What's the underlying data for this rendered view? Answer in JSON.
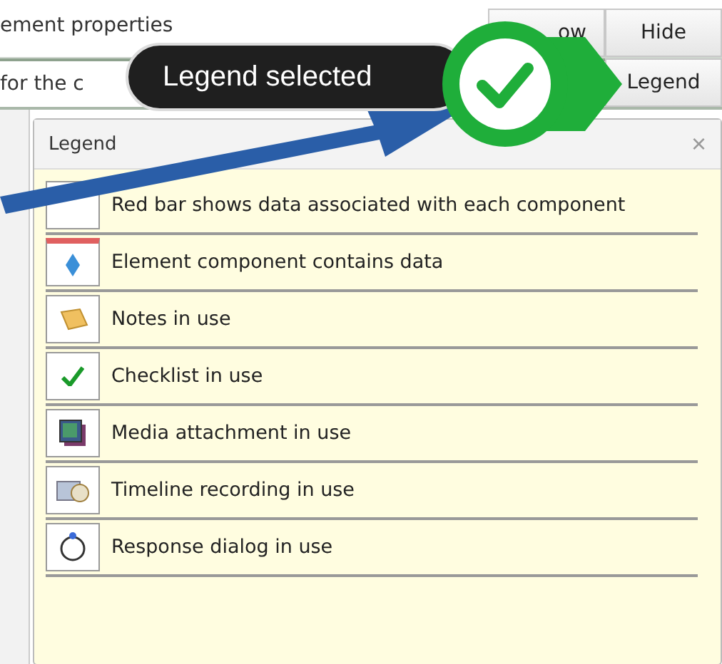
{
  "toolbar": {
    "title": "ement properties",
    "buttons": [
      {
        "label": "ow"
      },
      {
        "label": "Hide"
      }
    ]
  },
  "field": {
    "value": "for the c"
  },
  "legend_button": {
    "label": "Legend"
  },
  "callout": {
    "text": "Legend selected"
  },
  "legend_panel": {
    "title": "Legend",
    "close": "×",
    "items": [
      {
        "kind": "blank",
        "red_bar": false,
        "label": "Red bar shows data associated with each component"
      },
      {
        "kind": "diamond",
        "red_bar": true,
        "label": "Element component contains data"
      },
      {
        "kind": "notes",
        "red_bar": false,
        "label": "Notes in use"
      },
      {
        "kind": "check",
        "red_bar": false,
        "label": "Checklist in use"
      },
      {
        "kind": "media",
        "red_bar": false,
        "label": "Media attachment in use"
      },
      {
        "kind": "timeline",
        "red_bar": false,
        "label": "Timeline recording in use"
      },
      {
        "kind": "response",
        "red_bar": false,
        "label": "Response dialog in use"
      }
    ]
  }
}
